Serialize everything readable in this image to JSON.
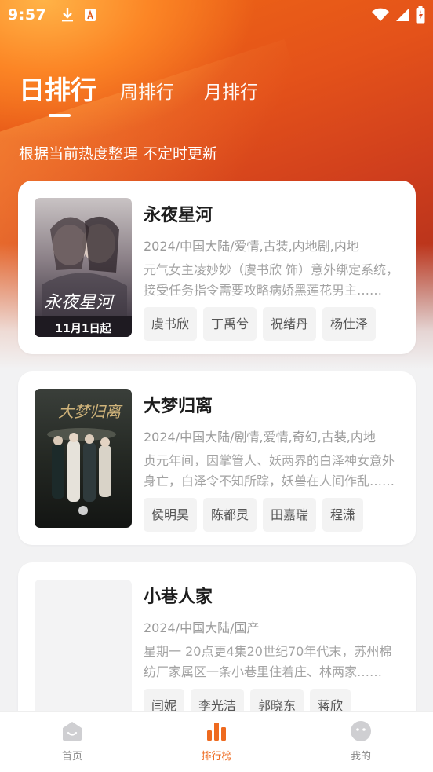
{
  "status": {
    "time": "9:57"
  },
  "tabs": [
    {
      "label": "日排行"
    },
    {
      "label": "周排行"
    },
    {
      "label": "月排行"
    }
  ],
  "subtitle": "根据当前热度整理 不定时更新",
  "shows": [
    {
      "title": "永夜星河",
      "meta": "2024/中国大陆/爱情,古装,内地剧,内地",
      "desc": "元气女主凌妙妙（虞书欣 饰）意外绑定系统，接受任务指令需要攻略病娇黑莲花男主……",
      "cast": [
        "虞书欣",
        "丁禹兮",
        "祝绪丹",
        "杨仕泽"
      ],
      "poster_text": "永夜星河",
      "poster_tag": "11月1日起"
    },
    {
      "title": "大梦归离",
      "meta": "2024/中国大陆/剧情,爱情,奇幻,古装,内地",
      "desc": "贞元年间，因掌管人、妖两界的白泽神女意外身亡，白泽令不知所踪，妖兽在人间作乱……",
      "cast": [
        "侯明昊",
        "陈都灵",
        "田嘉瑞",
        "程潇"
      ],
      "poster_text": "大梦归离"
    },
    {
      "title": "小巷人家",
      "meta": "2024/中国大陆/国产",
      "desc": "星期一 20点更4集20世纪70年代末，苏州棉纺厂家属区一条小巷里住着庄、林两家……",
      "cast": [
        "闫妮",
        "李光洁",
        "郭晓东",
        "蒋欣"
      ]
    }
  ],
  "tabbar": [
    {
      "label": "首页",
      "icon": "home-icon"
    },
    {
      "label": "排行榜",
      "icon": "ranking-icon"
    },
    {
      "label": "我的",
      "icon": "profile-icon"
    }
  ],
  "colors": {
    "accent": "#ee6a1f",
    "hero_start": "#f06a14",
    "hero_end": "#8e2a1f"
  }
}
